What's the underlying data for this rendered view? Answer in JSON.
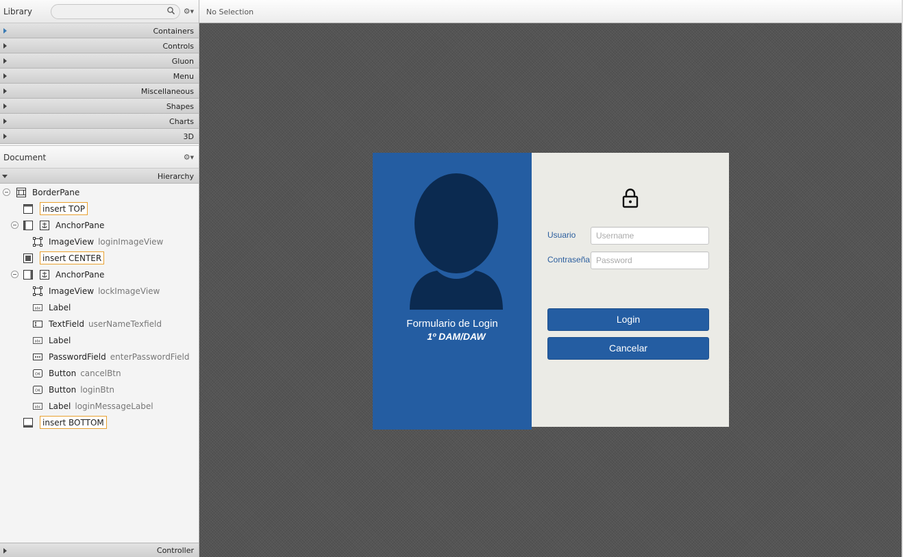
{
  "library": {
    "title": "Library",
    "search_value": "",
    "categories": [
      {
        "label": "Containers"
      },
      {
        "label": "Controls"
      },
      {
        "label": "Gluon"
      },
      {
        "label": "Menu"
      },
      {
        "label": "Miscellaneous"
      },
      {
        "label": "Shapes"
      },
      {
        "label": "Charts"
      },
      {
        "label": "3D"
      }
    ]
  },
  "document": {
    "title": "Document",
    "hierarchy_label": "Hierarchy",
    "tree": {
      "border_pane": "BorderPane",
      "insert_top": "insert TOP",
      "anchor_pane_1": "AnchorPane",
      "imageview_1": {
        "type": "ImageView",
        "id": "loginImageView"
      },
      "insert_center": "insert CENTER",
      "anchor_pane_2": "AnchorPane",
      "imageview_2": {
        "type": "ImageView",
        "id": "lockImageView"
      },
      "label_1": "Label",
      "textfield": {
        "type": "TextField",
        "id": "userNameTexfield"
      },
      "label_2": "Label",
      "passwordfield": {
        "type": "PasswordField",
        "id": "enterPasswordField"
      },
      "button_cancel": {
        "type": "Button",
        "id": "cancelBtn"
      },
      "button_login": {
        "type": "Button",
        "id": "loginBtn"
      },
      "label_message": {
        "type": "Label",
        "id": "loginMessageLabel"
      },
      "insert_bottom": "insert BOTTOM"
    },
    "controller_label": "Controller"
  },
  "canvas": {
    "selection_status": "No Selection"
  },
  "login_form": {
    "title": "Formulario de Login",
    "subtitle": "1º DAM/DAW",
    "usuario_label": "Usuario",
    "username_placeholder": "Username",
    "contrasena_label": "Contraseña",
    "password_placeholder": "Password",
    "login_label": "Login",
    "cancel_label": "Cancelar"
  },
  "icons": {
    "search": "search-icon",
    "gear": "gear-icon",
    "lock": "lock-icon",
    "avatar": "user-silhouette"
  },
  "colors": {
    "form_blue": "#245da2",
    "form_grey": "#ebebe6",
    "avatar_dark": "#0b2a50",
    "insert_border": "#e8a02f",
    "canvas_bg": "#555555"
  }
}
